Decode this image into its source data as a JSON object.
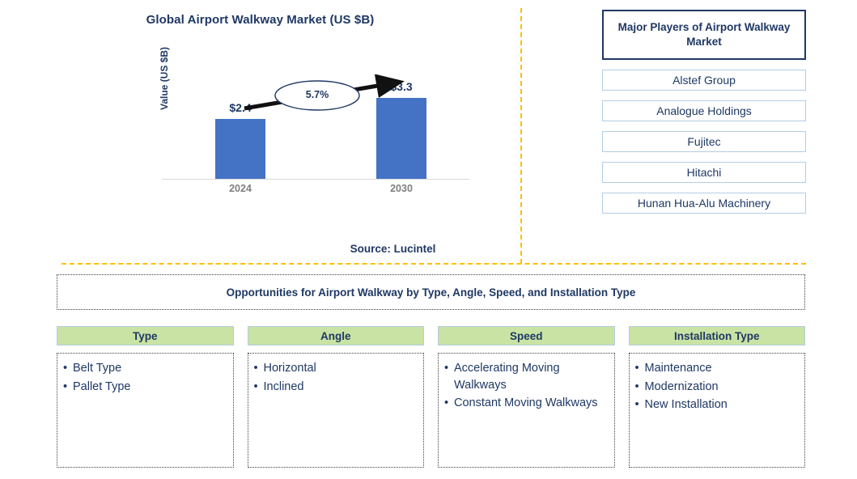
{
  "chart_data": {
    "type": "bar",
    "title": "Global Airport Walkway Market (US $B)",
    "xlabel": "",
    "ylabel": "Value (US $B)",
    "categories": [
      "2024",
      "2030"
    ],
    "values": [
      2.4,
      3.3
    ],
    "value_labels": [
      "$2.4",
      "$3.3"
    ],
    "ylim": [
      0,
      3.6
    ],
    "grid": false,
    "legend": "none",
    "annotation": "5.7%",
    "annotation_type": "cagr-arrow",
    "bar_color": "#4472C4",
    "source": "Source: Lucintel"
  },
  "chart": {
    "title": "Global Airport Walkway Market (US $B)",
    "y_axis_label": "Value (US $B)",
    "cagr": "5.7%",
    "bars": [
      {
        "category": "2024",
        "label": "$2.4"
      },
      {
        "category": "2030",
        "label": "$3.3"
      }
    ],
    "source": "Source: Lucintel"
  },
  "players": {
    "header": "Major Players of Airport Walkway Market",
    "items": [
      {
        "name": "Alstef Group"
      },
      {
        "name": "Analogue Holdings"
      },
      {
        "name": "Fujitec"
      },
      {
        "name": "Hitachi"
      },
      {
        "name": "Hunan Hua-Alu Machinery"
      }
    ]
  },
  "opportunities": {
    "banner": "Opportunities for Airport Walkway by Type, Angle, Speed, and Installation Type",
    "columns": [
      {
        "header": "Type",
        "items": [
          "Belt Type",
          "Pallet Type"
        ]
      },
      {
        "header": "Angle",
        "items": [
          "Horizontal",
          "Inclined"
        ]
      },
      {
        "header": "Speed",
        "items": [
          "Accelerating Moving Walkways",
          "Constant Moving Walkways"
        ]
      },
      {
        "header": "Installation Type",
        "items": [
          "Maintenance",
          "Modernization",
          "New Installation"
        ]
      }
    ]
  },
  "colors": {
    "navy": "#1F3864",
    "bar_blue": "#4472C4",
    "header_green": "#C9E3A4",
    "divider_orange": "#FFC000",
    "box_border_blue": "#B4CDE4",
    "category_gray": "#7F7F7F"
  }
}
